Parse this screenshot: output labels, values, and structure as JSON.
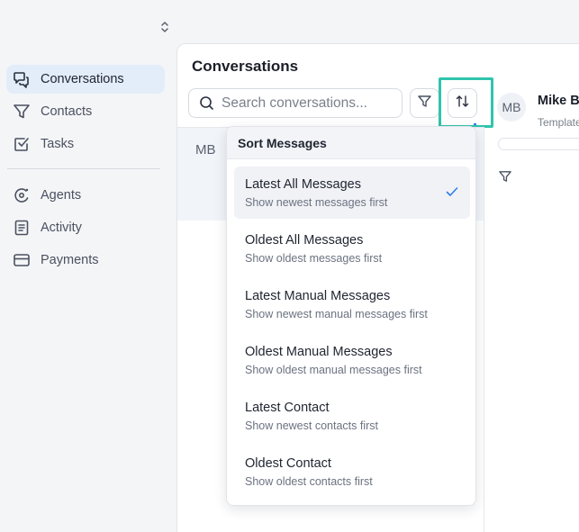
{
  "sidebar": {
    "items": [
      {
        "label": "Conversations",
        "icon": "chat-bubbles-icon",
        "active": true
      },
      {
        "label": "Contacts",
        "icon": "filter-funnel-icon",
        "active": false
      },
      {
        "label": "Tasks",
        "icon": "checkbox-icon",
        "active": false
      },
      {
        "label": "Agents",
        "icon": "agents-icon",
        "active": false
      },
      {
        "label": "Activity",
        "icon": "activity-log-icon",
        "active": false
      },
      {
        "label": "Payments",
        "icon": "credit-card-icon",
        "active": false
      }
    ]
  },
  "main": {
    "title": "Conversations",
    "search": {
      "placeholder": "Search conversations...",
      "value": ""
    },
    "list": {
      "avatar_initials": "MB"
    }
  },
  "detail": {
    "avatar_initials": "MB",
    "name": "Mike Br",
    "subtitle": "Template"
  },
  "sort_menu": {
    "title": "Sort Messages",
    "options": [
      {
        "title": "Latest All Messages",
        "subtitle": "Show newest messages first",
        "selected": true
      },
      {
        "title": "Oldest All Messages",
        "subtitle": "Show oldest messages first",
        "selected": false
      },
      {
        "title": "Latest Manual Messages",
        "subtitle": "Show newest manual messages first",
        "selected": false
      },
      {
        "title": "Oldest Manual Messages",
        "subtitle": "Show oldest manual messages first",
        "selected": false
      },
      {
        "title": "Latest Contact",
        "subtitle": "Show newest contacts first",
        "selected": false
      },
      {
        "title": "Oldest Contact",
        "subtitle": "Show oldest contacts first",
        "selected": false
      }
    ]
  },
  "colors": {
    "accent": "#2f7fe6",
    "highlight": "#2fc4ad",
    "active_nav_bg": "#e3edf9"
  }
}
